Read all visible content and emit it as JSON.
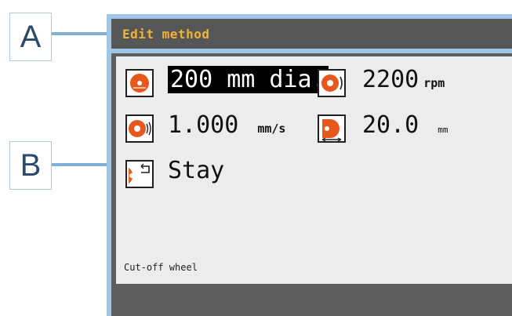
{
  "callouts": {
    "a": "A",
    "b": "B"
  },
  "title_bar": {
    "title": "Edit method"
  },
  "params": {
    "diameter": {
      "value": "200 mm dia.",
      "icon": "cut-off-wheel-icon"
    },
    "speed": {
      "value": "2200",
      "unit": "rpm",
      "icon": "wheel-rotation-icon"
    },
    "feed": {
      "value": "1.000",
      "unit": "mm/s",
      "icon": "feed-speed-icon"
    },
    "distance": {
      "value": "20.0",
      "unit": "mm",
      "icon": "cut-length-icon"
    },
    "end_position": {
      "value": "Stay",
      "icon": "end-position-icon"
    }
  },
  "footer": {
    "wheel_type": "Cut-off wheel"
  },
  "colors": {
    "accent": "#f0b33a",
    "wheel": "#e8581c",
    "frame": "#9fc6e6",
    "panel": "#ececec",
    "bar": "#565656"
  }
}
